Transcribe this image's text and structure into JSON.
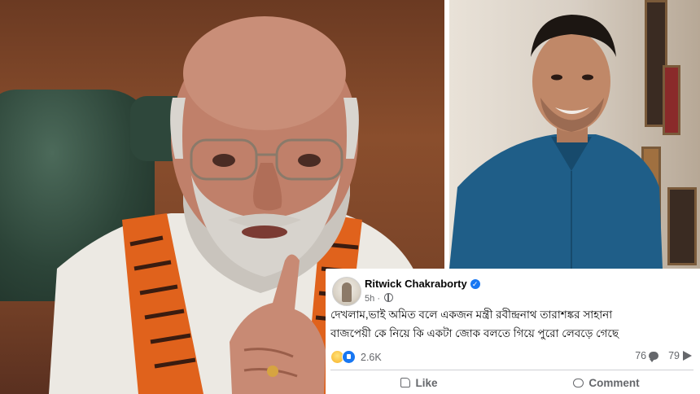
{
  "post": {
    "author": "Ritwick Chakraborty",
    "verified_icon": "verified-badge-icon",
    "time": "5h",
    "visibility_icon": "globe-icon",
    "text_line1": "দেখলাম,ভাই অমিত বলে একজন মন্ত্রী রবীন্দ্রনাথ তারাশঙ্কর সাহানা",
    "text_line2": "বাজপেয়ী কে নিয়ে কি একটা জোক বলতে গিয়ে পুরো লেবড়ে গেছে",
    "reactions_count": "2.6K",
    "comments_count": "76",
    "shares_count": "79",
    "like_label": "Like",
    "comment_label": "Comment"
  },
  "colors": {
    "facebook_blue": "#1877f2",
    "secondary_text": "#65676b",
    "primary_text": "#050505"
  }
}
